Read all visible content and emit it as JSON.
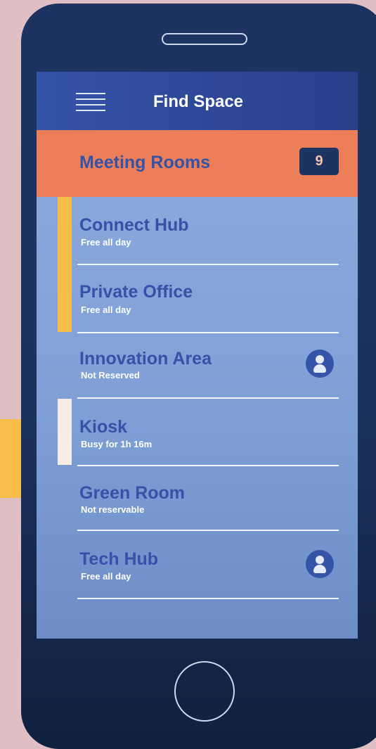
{
  "header": {
    "title": "Find Space",
    "menu_icon": "hamburger-menu-icon"
  },
  "category": {
    "title": "Meeting Rooms",
    "count": "9",
    "color": "#ec7f5a"
  },
  "rooms": [
    {
      "name": "Connect Hub",
      "status": "Free all day",
      "accent": "#f6bd49",
      "icon": null
    },
    {
      "name": "Private Office",
      "status": "Free all day",
      "accent": "#f6bd49",
      "icon": null
    },
    {
      "name": "Innovation Area",
      "status": "Not Reserved",
      "accent": null,
      "icon": "person-icon"
    },
    {
      "name": "Kiosk",
      "status": "Busy for 1h 16m",
      "accent": "#f7ebe6",
      "icon": null
    },
    {
      "name": "Green Room",
      "status": "Not reservable",
      "accent": null,
      "icon": null
    },
    {
      "name": "Tech Hub",
      "status": "Free all day",
      "accent": null,
      "icon": "person-icon"
    }
  ],
  "colors": {
    "background": "#dfbfc4",
    "phone": "#1d3462",
    "header": "#3553a7",
    "room_text": "#3552a8"
  }
}
